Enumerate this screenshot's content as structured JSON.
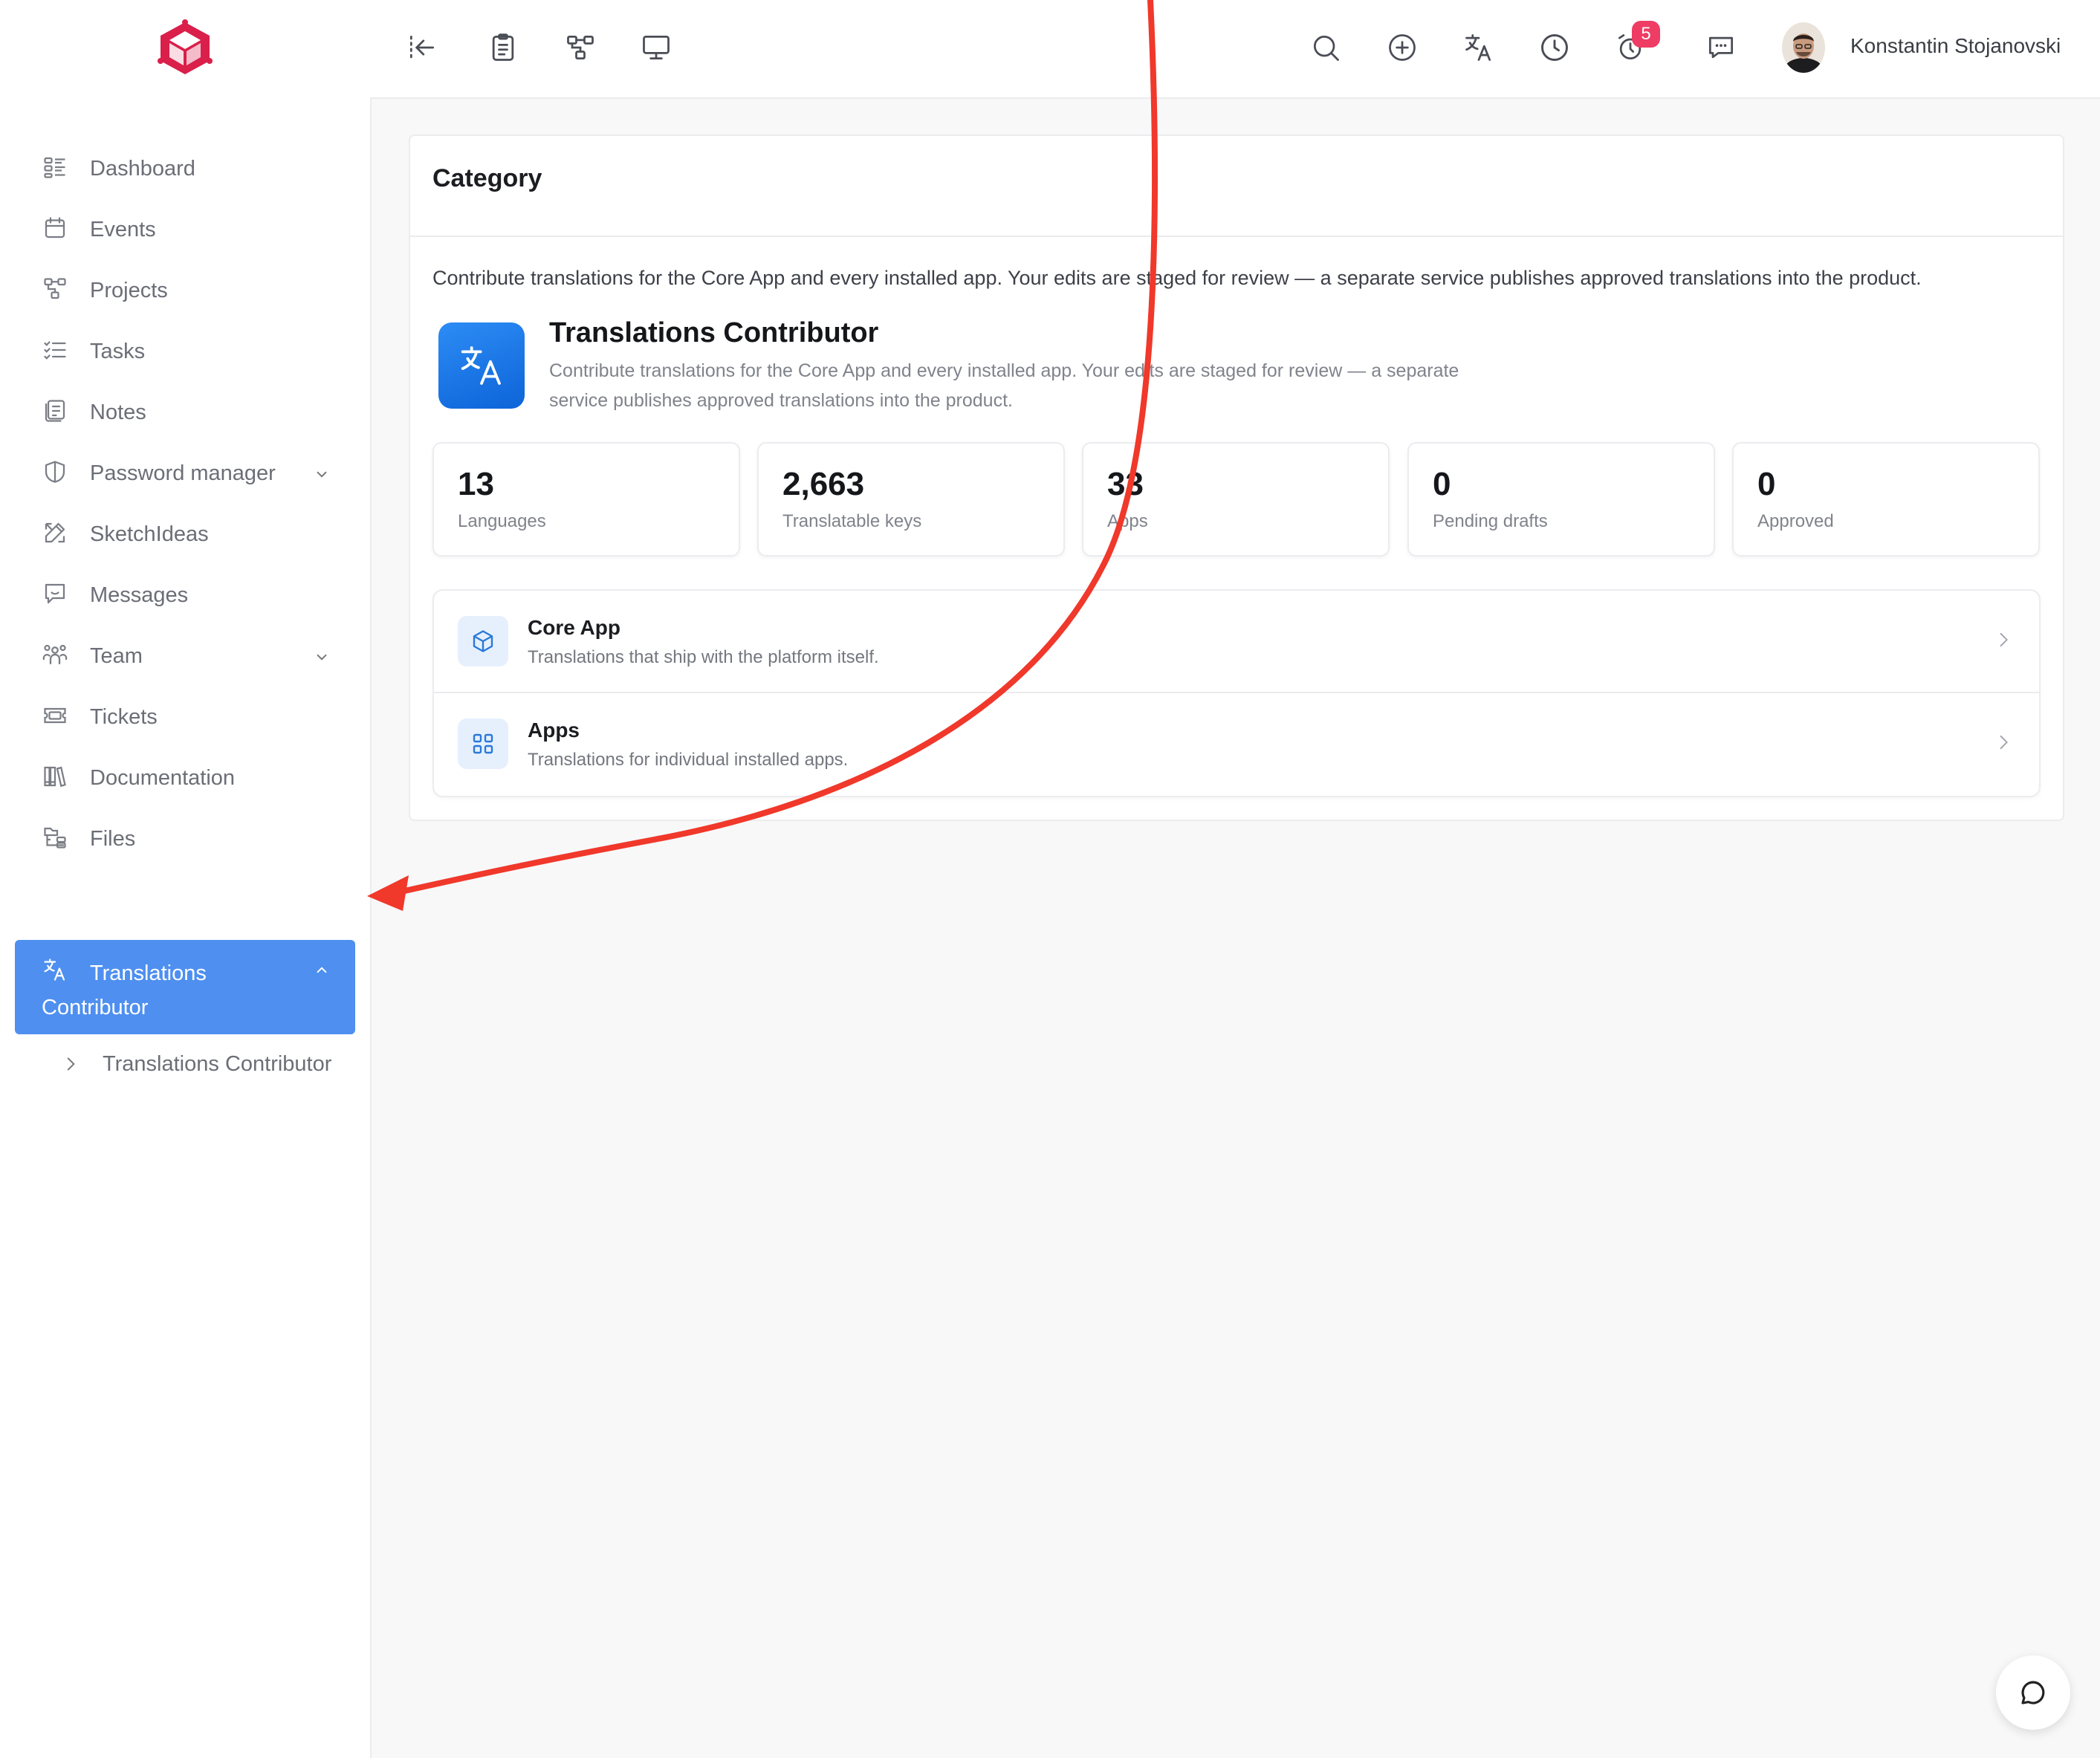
{
  "user": {
    "name": "Konstantin Stojanovski"
  },
  "notifications": {
    "reminders_count": "5"
  },
  "sidebar": {
    "items": [
      {
        "label": "Dashboard",
        "icon": "dashboard-icon"
      },
      {
        "label": "Events",
        "icon": "calendar-icon"
      },
      {
        "label": "Projects",
        "icon": "projects-icon"
      },
      {
        "label": "Tasks",
        "icon": "tasks-icon"
      },
      {
        "label": "Notes",
        "icon": "notes-icon"
      },
      {
        "label": "Password manager",
        "icon": "shield-icon"
      },
      {
        "label": "SketchIdeas",
        "icon": "sketch-icon"
      },
      {
        "label": "Messages",
        "icon": "message-icon"
      },
      {
        "label": "Team",
        "icon": "team-icon"
      },
      {
        "label": "Tickets",
        "icon": "ticket-icon"
      },
      {
        "label": "Documentation",
        "icon": "books-icon"
      },
      {
        "label": "Files",
        "icon": "files-icon"
      }
    ],
    "active": {
      "label": "Translations Contributor",
      "icon": "translate-icon"
    },
    "sub_item": {
      "label": "Translations Contributor"
    }
  },
  "page": {
    "category_title": "Category",
    "description": "Contribute translations for the Core App and every installed app. Your edits are staged for review — a separate service publishes approved translations into the product.",
    "hero": {
      "title": "Translations Contributor",
      "subtitle": "Contribute translations for the Core App and every installed app. Your edits are staged for review — a separate service publishes approved translations into the product."
    },
    "stats": [
      {
        "value": "13",
        "label": "Languages"
      },
      {
        "value": "2,663",
        "label": "Translatable keys"
      },
      {
        "value": "33",
        "label": "Apps"
      },
      {
        "value": "0",
        "label": "Pending drafts"
      },
      {
        "value": "0",
        "label": "Approved"
      }
    ],
    "rows": [
      {
        "title": "Core App",
        "subtitle": "Translations that ship with the platform itself.",
        "icon": "cube-icon"
      },
      {
        "title": "Apps",
        "subtitle": "Translations for individual installed apps.",
        "icon": "grid-icon"
      }
    ]
  },
  "colors": {
    "accent": "#4e8ff0",
    "brand": "#d91f4a",
    "badge": "#ee3c64",
    "annotation_arrow": "#f0382b"
  }
}
